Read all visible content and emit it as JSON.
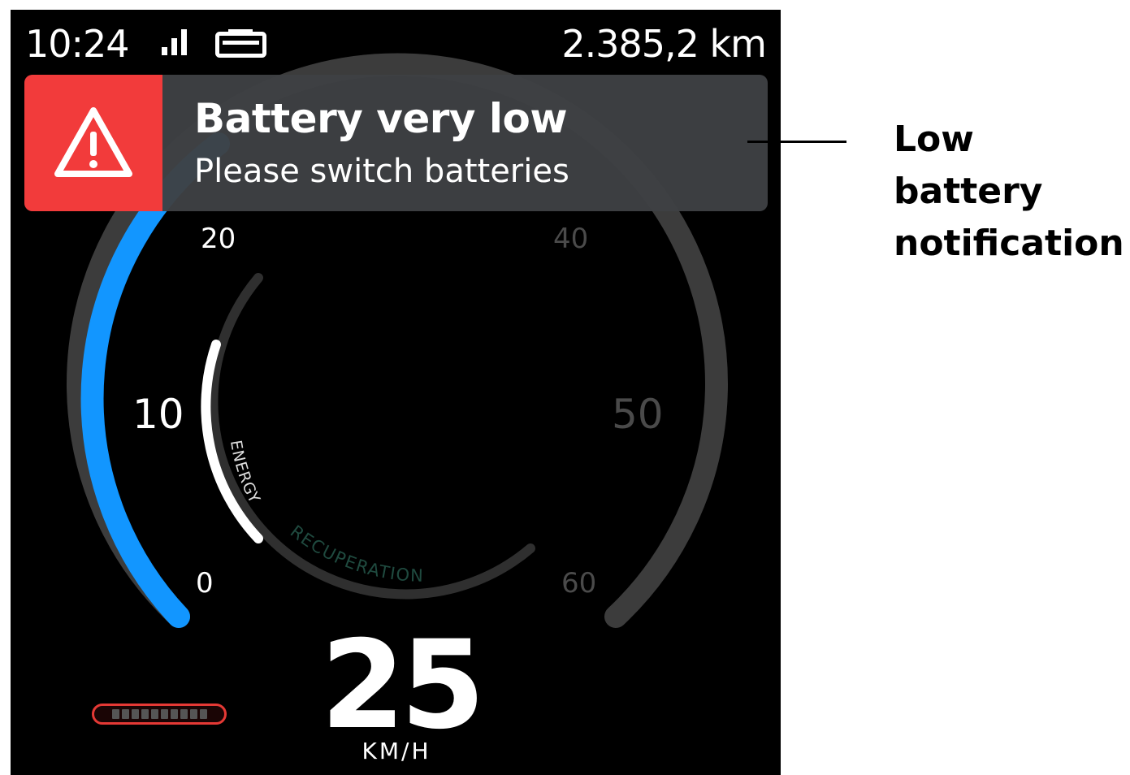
{
  "status_bar": {
    "time": "10:24",
    "odometer": "2.385,2 km"
  },
  "icons": {
    "signal": "signal-strength-icon",
    "battery": "battery-icon",
    "alert": "warning-triangle-icon"
  },
  "colors": {
    "screen_bg": "#000000",
    "speed_arc": "#1296ff",
    "alert_red": "#f23b3b",
    "notification_bg": "#3e4144",
    "recuperation_text": "#1f4a3f",
    "battery_outline": "#e53935"
  },
  "notification": {
    "title": "Battery very low",
    "subtitle": "Please switch batteries"
  },
  "speed_scale": {
    "labels": [
      "0",
      "10",
      "20",
      "40",
      "50",
      "60"
    ]
  },
  "speedometer": {
    "value": "25",
    "unit": "KM/H"
  },
  "energy_gauge": {
    "energy_label": "ENERGY",
    "recuperation_label": "RECUPERATION",
    "energy_level_fraction": 0.5
  },
  "battery_level": {
    "cells": 10,
    "filled": 0
  },
  "annotation": {
    "label_line1": "Low battery",
    "label_line2": "notification"
  }
}
